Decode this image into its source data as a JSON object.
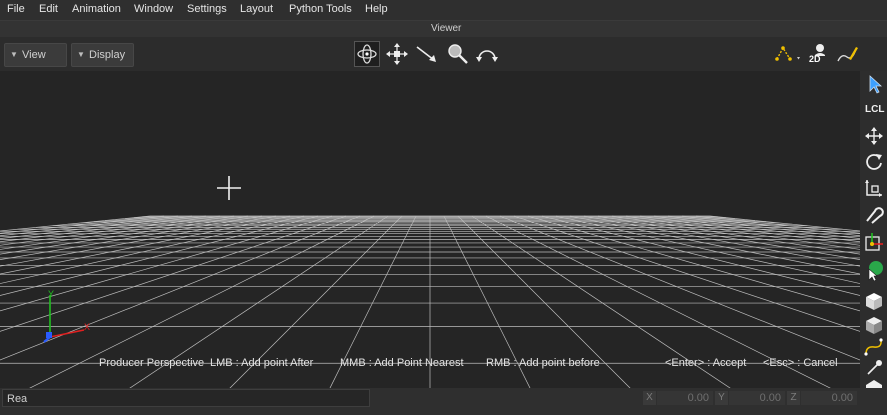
{
  "menu": {
    "items": [
      "File",
      "Edit",
      "Animation",
      "Window",
      "Settings",
      "Layout",
      "Python Tools",
      "Help"
    ]
  },
  "viewer": {
    "title": "Viewer"
  },
  "toolbar": {
    "view_label": "View",
    "display_label": "Display",
    "tools": [
      "orbit-icon",
      "pan-icon",
      "dolly-icon",
      "zoom-icon",
      "roll-icon"
    ],
    "right_tools": [
      "curve-path-icon",
      "2d-view-icon",
      "pen-icon"
    ],
    "two_d_label": "2D"
  },
  "viewport": {
    "status": {
      "camera": "Producer Perspective",
      "lmb": "LMB : Add point After",
      "mmb": "MMB : Add Point Nearest",
      "rmb": "RMB : Add point before",
      "enter": "<Enter> : Accept",
      "esc": "<Esc> : Cancel"
    },
    "axis": {
      "y": "Y",
      "x": "X"
    }
  },
  "sidebar": {
    "tools": [
      "select-icon",
      "local-icon",
      "move-icon",
      "rotate-icon",
      "scale-icon",
      "snap-icon",
      "pivot-icon",
      "globe-select-icon",
      "cube-solid-icon",
      "cube-shaded-icon",
      "path-icon",
      "light-icon",
      "shape-icon"
    ],
    "lcl_label": "LCL"
  },
  "bottom": {
    "command_placeholder": "Rea",
    "x_label": "X",
    "x_value": "0.00",
    "y_label": "Y",
    "y_value": "0.00",
    "z_label": "Z",
    "z_value": "0.00"
  },
  "colors": {
    "accent_yellow": "#f0c000",
    "axis_x": "#e02020",
    "axis_y": "#20c020",
    "axis_z": "#2a5cff",
    "grid": "#bdbdbd"
  }
}
